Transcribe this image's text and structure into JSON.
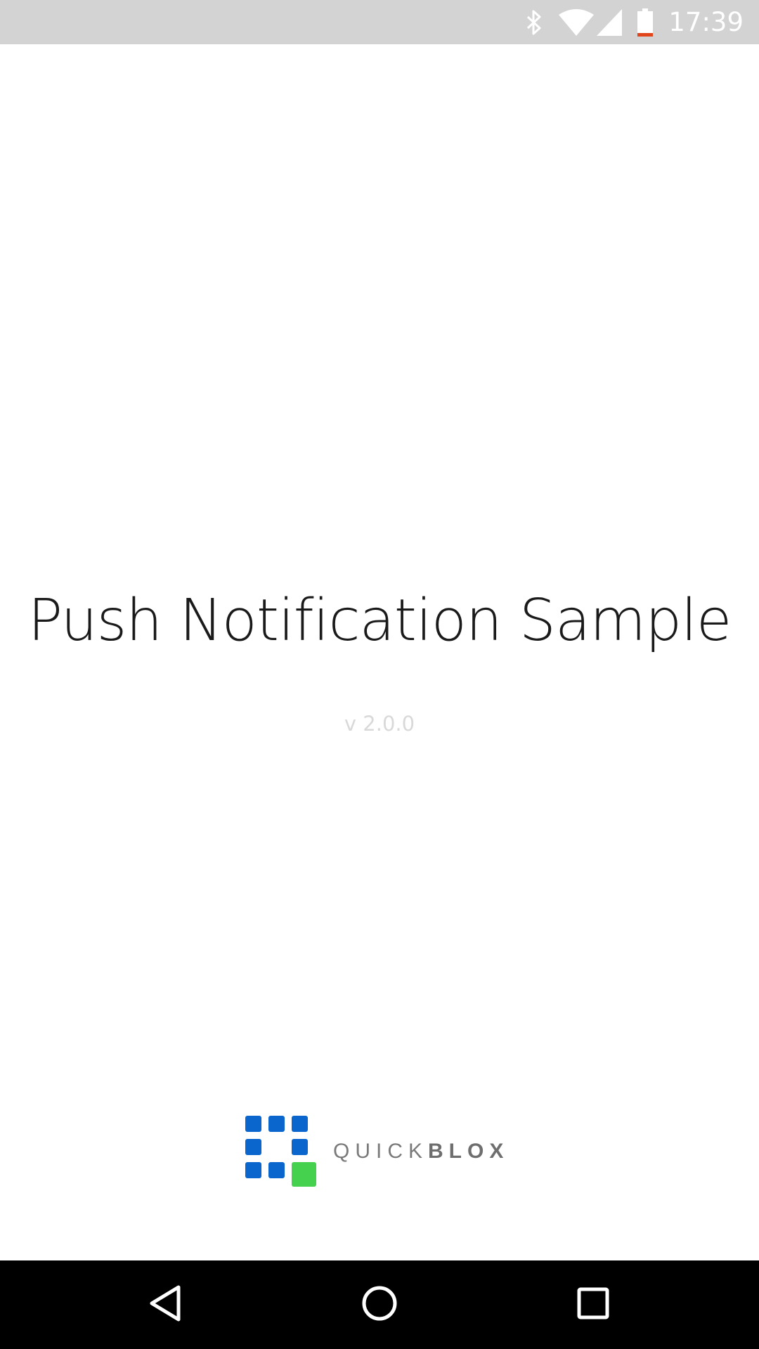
{
  "status_bar": {
    "time": "17:39",
    "icons": [
      "bluetooth-icon",
      "wifi-icon",
      "cell-signal-icon",
      "battery-low-icon"
    ],
    "battery_warning_color": "#e0451c"
  },
  "splash": {
    "title": "Push Notification Sample",
    "version": "v 2.0.0"
  },
  "brand": {
    "name_light": "QUICK",
    "name_bold": "BLOX",
    "primary_color": "#0a66cc",
    "accent_color": "#45d04e"
  },
  "nav_bar": {
    "buttons": [
      "back-icon",
      "home-icon",
      "recents-icon"
    ]
  }
}
